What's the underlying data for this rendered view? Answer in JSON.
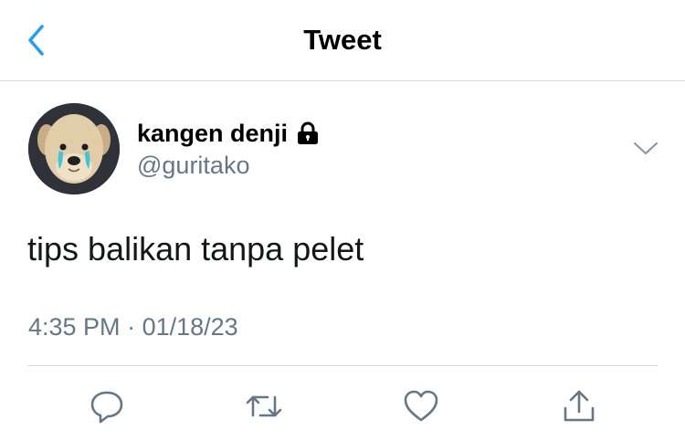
{
  "header": {
    "back_icon": "chevron-left-icon",
    "title": "Tweet"
  },
  "tweet": {
    "author": {
      "display_name": "kangen denji",
      "handle": "@guritako",
      "protected_icon": "lock-icon",
      "avatar": "crying-puppy-avatar"
    },
    "menu_icon": "chevron-down-icon",
    "text": "tips balikan tanpa pelet",
    "time": "4:35 PM",
    "separator": "·",
    "date": "01/18/23"
  },
  "actions": [
    {
      "icon": "reply-icon"
    },
    {
      "icon": "retweet-icon"
    },
    {
      "icon": "like-icon"
    },
    {
      "icon": "share-icon"
    }
  ],
  "colors": {
    "accent": "#1da1f2",
    "secondary_text": "#657786",
    "divider": "#d5d8db",
    "icon_gray": "#657786"
  }
}
